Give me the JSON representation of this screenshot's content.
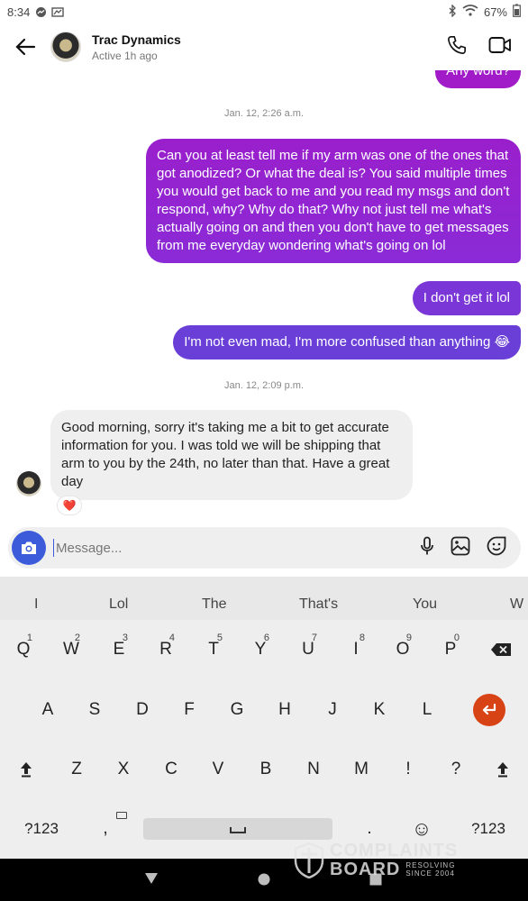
{
  "status": {
    "time": "8:34",
    "battery": "67%"
  },
  "header": {
    "name": "Trac Dynamics",
    "active": "Active 1h ago"
  },
  "messages": {
    "partial_top": "Any word?",
    "stamp1": "Jan. 12, 2:26 a.m.",
    "out1": "Can you at least tell me if my arm was one of the ones that got anodized? Or what the deal is? You said multiple times you would get back to me and you read my msgs and don't respond, why? Why do that? Why not just tell me what's actually going on and then you don't have to get messages from me everyday wondering what's going on lol",
    "out2": "I don't get it lol",
    "out3": "I'm not even mad, I'm more confused than anything 😂",
    "stamp2": "Jan. 12, 2:09 p.m.",
    "in1": "Good morning, sorry it's taking me a bit to get accurate information for you. I was told we will be shipping that arm to you by the 24th, no later than that. Have a great day",
    "reaction": "❤️"
  },
  "composer": {
    "placeholder": "Message..."
  },
  "keyboard": {
    "suggestions": [
      "I",
      "Lol",
      "The",
      "That's",
      "You",
      "W"
    ],
    "row1": [
      "Q",
      "W",
      "E",
      "R",
      "T",
      "Y",
      "U",
      "I",
      "O",
      "P"
    ],
    "row1_nums": [
      "1",
      "2",
      "3",
      "4",
      "5",
      "6",
      "7",
      "8",
      "9",
      "0"
    ],
    "row2": [
      "A",
      "S",
      "D",
      "F",
      "G",
      "H",
      "J",
      "K",
      "L"
    ],
    "row3": [
      "Z",
      "X",
      "C",
      "V",
      "B",
      "N",
      "M",
      "!",
      "?"
    ],
    "sym_left": "?123",
    "sym_right": "?123",
    "comma": ",",
    "period": ".",
    "emoji": "☺"
  },
  "watermark": {
    "line1": "COMPLAINTS",
    "line2": "BOARD",
    "tag1": "RESOLVING",
    "tag2": "SINCE 2004"
  },
  "colors": {
    "bubble_top": "#a21bc9",
    "bubble_mid": "#8a2bd6",
    "bubble_bottom": "#6a3fd8",
    "accent": "#3b5bdb",
    "enter": "#d84315"
  }
}
